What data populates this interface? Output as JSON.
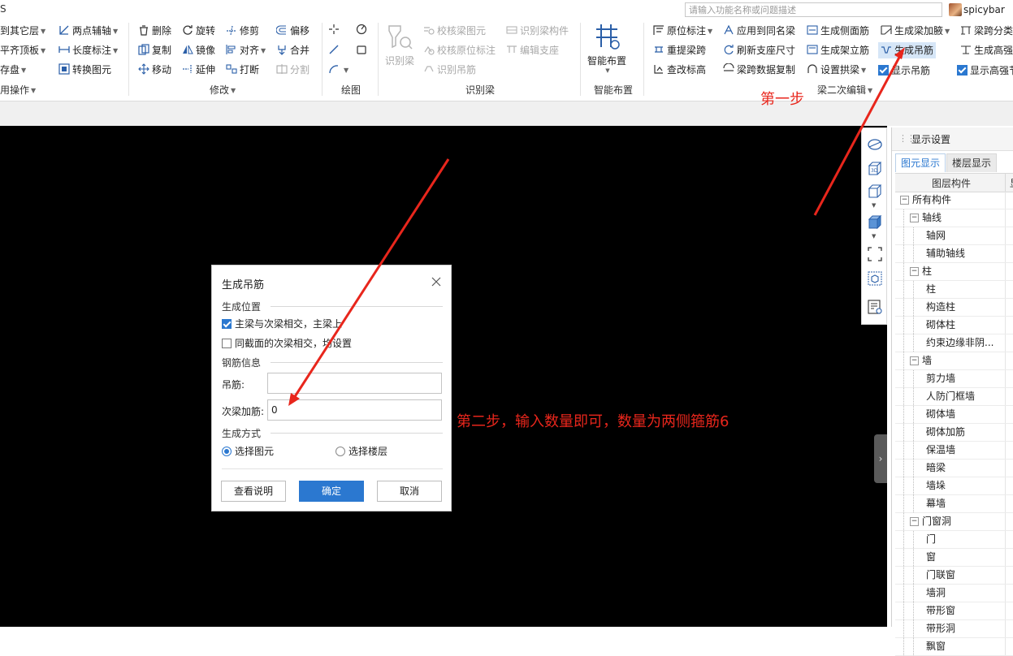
{
  "topbar": {
    "app_glyph": "S",
    "search_placeholder": "请输入功能名称或问题描述",
    "username": "spicybar"
  },
  "ribbon": {
    "group0": {
      "items": [
        "到其它层",
        "平齐顶板",
        "存盘",
        "两点辅轴",
        "长度标注",
        "转换图元"
      ],
      "title": "用操作"
    },
    "modify": {
      "items": [
        "删除",
        "复制",
        "移动",
        "旋转",
        "镜像",
        "延伸",
        "修剪",
        "对齐",
        "打断",
        "偏移",
        "合并",
        "分割"
      ],
      "title": "修改"
    },
    "draw": {
      "title": "绘图"
    },
    "identify": {
      "big_label": "识别梁",
      "items": [
        "校核梁图元",
        "校核原位标注",
        "识别吊筋",
        "识别梁构件",
        "编辑支座"
      ],
      "title": "识别梁"
    },
    "smart": {
      "big_label": "智能布置",
      "title": "智能布置"
    },
    "beam2": {
      "items": [
        "原位标注",
        "重提梁跨",
        "查改标高",
        "应用到同名梁",
        "刷新支座尺寸",
        "梁跨数据复制",
        "生成侧面筋",
        "生成架立筋",
        "设置拱梁",
        "生成梁加腋",
        "生成吊筋",
        "显示吊筋",
        "梁跨分类",
        "生成高强",
        "显示高强节"
      ],
      "title": "梁二次编辑"
    }
  },
  "annotations": {
    "step1": "第一步",
    "step2": "第二步，输入数量即可，数量为两侧箍筋6"
  },
  "dialog": {
    "title": "生成吊筋",
    "section_position": "生成位置",
    "check1": "主梁与次梁相交，主梁上",
    "check1_checked": true,
    "check2": "同截面的次梁相交，均设置",
    "check2_checked": false,
    "section_rebar": "钢筋信息",
    "hanger_label": "吊筋:",
    "hanger_value": "",
    "sec_beam_label": "次梁加筋:",
    "sec_beam_value": "0",
    "section_method": "生成方式",
    "radio1": "选择图元",
    "radio1_selected": true,
    "radio2": "选择楼层",
    "radio2_selected": false,
    "btn_help": "查看说明",
    "btn_ok": "确定",
    "btn_cancel": "取消"
  },
  "panel": {
    "title": "显示设置",
    "tabs": [
      "图元显示",
      "楼层显示"
    ],
    "column_header": "图层构件",
    "column_header_extra": "显",
    "tree": [
      {
        "label": "所有构件",
        "level": 0,
        "toggle": "−"
      },
      {
        "label": "轴线",
        "level": 1,
        "toggle": "−"
      },
      {
        "label": "轴网",
        "level": 2
      },
      {
        "label": "辅助轴线",
        "level": 2
      },
      {
        "label": "柱",
        "level": 1,
        "toggle": "−"
      },
      {
        "label": "柱",
        "level": 2
      },
      {
        "label": "构造柱",
        "level": 2
      },
      {
        "label": "砌体柱",
        "level": 2
      },
      {
        "label": "约束边缘非阴...",
        "level": 2
      },
      {
        "label": "墙",
        "level": 1,
        "toggle": "−"
      },
      {
        "label": "剪力墙",
        "level": 2
      },
      {
        "label": "人防门框墙",
        "level": 2
      },
      {
        "label": "砌体墙",
        "level": 2
      },
      {
        "label": "砌体加筋",
        "level": 2
      },
      {
        "label": "保温墙",
        "level": 2
      },
      {
        "label": "暗梁",
        "level": 2
      },
      {
        "label": "墙垛",
        "level": 2
      },
      {
        "label": "幕墙",
        "level": 2
      },
      {
        "label": "门窗洞",
        "level": 1,
        "toggle": "−"
      },
      {
        "label": "门",
        "level": 2
      },
      {
        "label": "窗",
        "level": 2
      },
      {
        "label": "门联窗",
        "level": 2
      },
      {
        "label": "墙洞",
        "level": 2
      },
      {
        "label": "带形窗",
        "level": 2
      },
      {
        "label": "带形洞",
        "level": 2
      },
      {
        "label": "飘窗",
        "level": 2
      }
    ]
  },
  "colors": {
    "accent": "#2b78d0",
    "annotation": "#e8261c",
    "canvas": "#000000"
  }
}
